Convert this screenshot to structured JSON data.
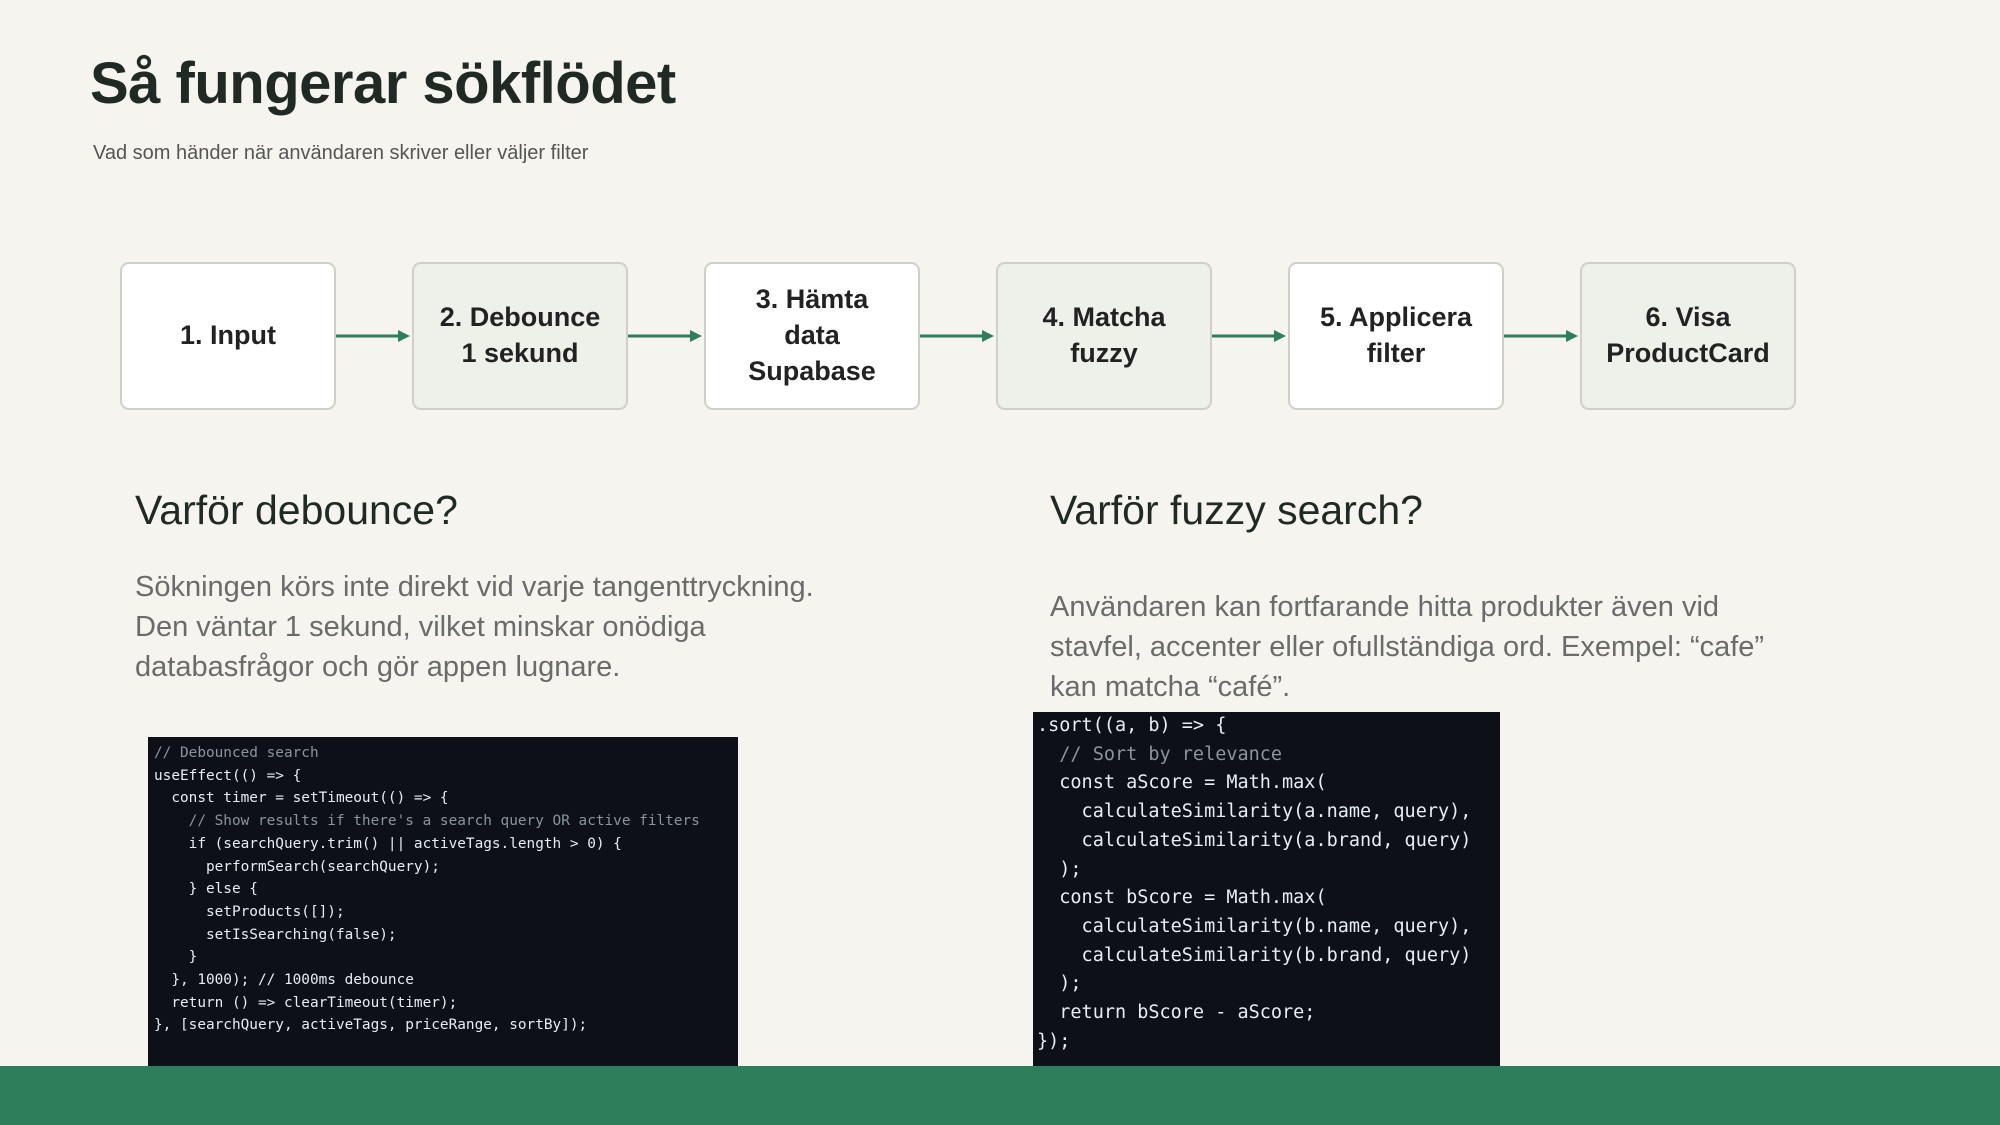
{
  "slide": {
    "title": "Så fungerar sökflödet",
    "subtitle": "Vad som händer när användaren skriver eller väljer filter"
  },
  "flow": {
    "steps": [
      {
        "label": "1. Input"
      },
      {
        "label": "2. Debounce\n1 sekund"
      },
      {
        "label": "3. Hämta\ndata\nSupabase"
      },
      {
        "label": "4. Matcha\nfuzzy"
      },
      {
        "label": "5. Applicera\nfilter"
      },
      {
        "label": "6. Visa\nProductCard"
      }
    ]
  },
  "debounce": {
    "heading": "Varför debounce?",
    "text": "Sökningen körs inte direkt vid varje tangenttryckning. Den väntar 1 sekund, vilket minskar onödiga databasfrågor och gör appen lugnare.",
    "code_lines": [
      "// Debounced search",
      "useEffect(() => {",
      "  const timer = setTimeout(() => {",
      "    // Show results if there's a search query OR active filters",
      "    if (searchQuery.trim() || activeTags.length > 0) {",
      "      performSearch(searchQuery);",
      "    } else {",
      "      setProducts([]);",
      "      setIsSearching(false);",
      "    }",
      "  }, 1000); // 1000ms debounce",
      "",
      "  return () => clearTimeout(timer);",
      "}, [searchQuery, activeTags, priceRange, sortBy]);"
    ]
  },
  "fuzzy": {
    "heading": "Varför fuzzy search?",
    "text": "Användaren kan fortfarande hitta produkter även vid stavfel, accenter eller ofullständiga ord. Exempel: “cafe” kan matcha “café”.",
    "code_lines": [
      ".sort((a, b) => {",
      "  // Sort by relevance",
      "  const aScore = Math.max(",
      "    calculateSimilarity(a.name, query),",
      "    calculateSimilarity(a.brand, query)",
      "  );",
      "  const bScore = Math.max(",
      "    calculateSimilarity(b.name, query),",
      "    calculateSimilarity(b.brand, query)",
      "  );",
      "  return bScore - aScore;",
      "});"
    ]
  },
  "colors": {
    "background": "#f5f4ee",
    "accent_green": "#2e7d5b",
    "code_background": "#0d1117"
  }
}
